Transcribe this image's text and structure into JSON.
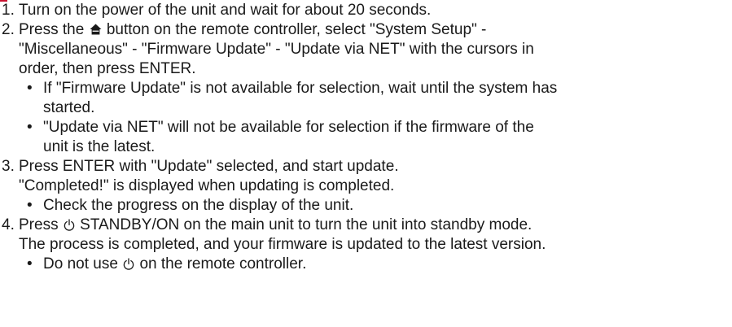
{
  "steps": [
    {
      "number": "1.",
      "lines": [
        "Turn on the power of the unit and wait for about 20 seconds."
      ]
    },
    {
      "number": "2.",
      "pre_icon": "Press the",
      "icon": "home-icon",
      "post_icon": "button on the remote controller, select \"System Setup\" -",
      "lines": [
        "\"Miscellaneous\" - \"Firmware Update\" - \"Update via NET\" with the cursors in",
        "order, then press ENTER."
      ],
      "bullets": [
        {
          "lines": [
            "If \"Firmware Update\" is not available for selection, wait until the system has",
            "started."
          ]
        },
        {
          "lines": [
            "\"Update via NET\" will not be available for selection if the firmware of the",
            "unit is the latest."
          ]
        }
      ]
    },
    {
      "number": "3.",
      "lines": [
        "Press ENTER with \"Update\" selected, and start update.",
        "\"Completed!\" is displayed when updating is completed."
      ],
      "bullets": [
        {
          "lines": [
            "Check the progress on the display of the unit."
          ]
        }
      ]
    },
    {
      "number": "4.",
      "pre_icon": "Press",
      "icon": "power-icon",
      "post_icon": "STANDBY/ON on the main unit to turn the unit into standby mode.",
      "lines": [
        "The process is completed, and your firmware is updated to the latest version."
      ],
      "bullets": [
        {
          "pre_icon": "Do not use",
          "icon": "power-icon",
          "post_icon": "on the remote controller."
        }
      ]
    }
  ],
  "bullet_glyph": "•",
  "colors": {
    "text": "#1a1a1a",
    "accent": "#c8102e"
  }
}
